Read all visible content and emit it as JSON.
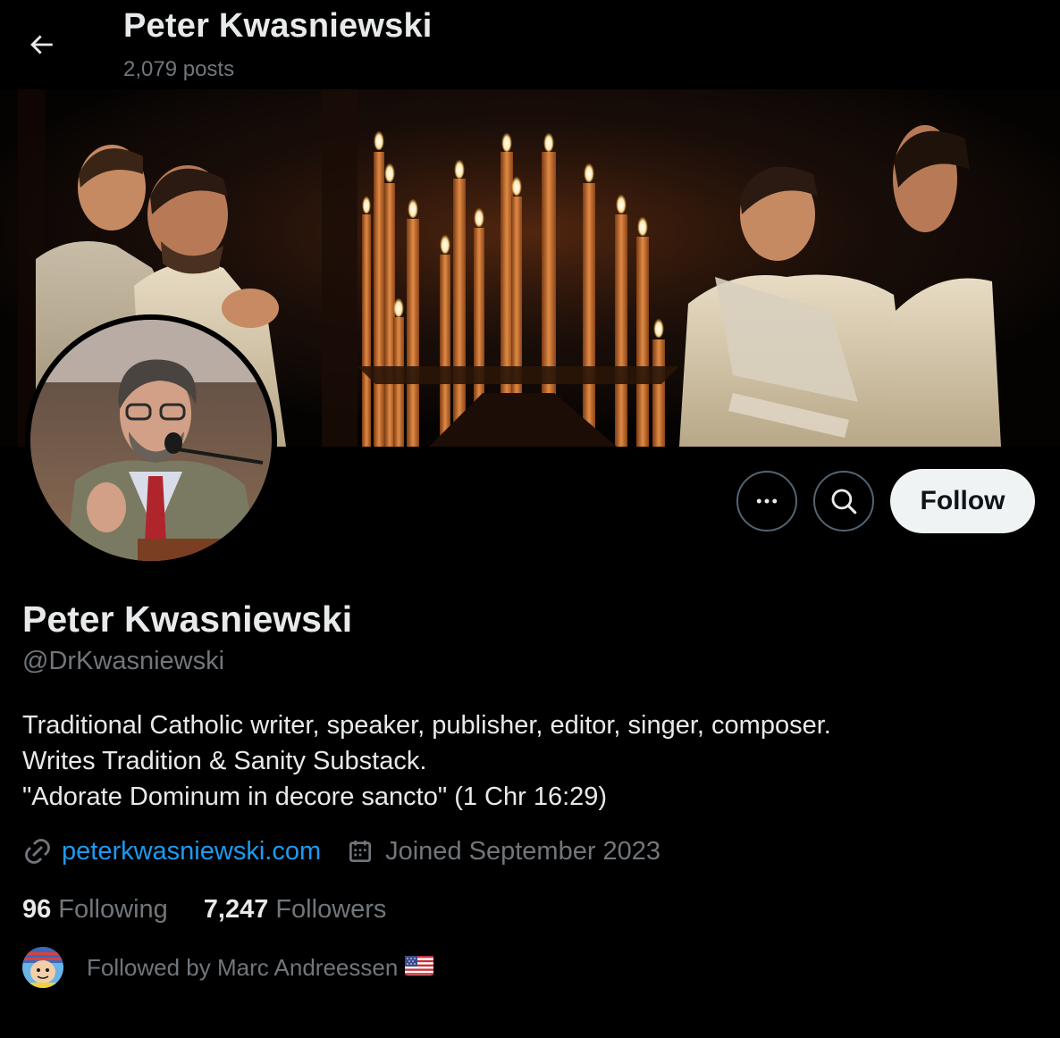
{
  "header": {
    "title": "Peter Kwasniewski",
    "posts_count": "2,079 posts",
    "back_icon": "arrow-left-icon"
  },
  "profile": {
    "name": "Peter Kwasniewski",
    "handle": "@DrKwasniewski",
    "bio_lines": [
      "Traditional Catholic writer, speaker, publisher, editor, singer, composer.",
      "Writes Tradition & Sanity Substack.",
      "\"Adorate Dominum in decore sancto\" (1 Chr 16:29)"
    ],
    "website": "peterkwasniewski.com",
    "joined": "Joined September 2023"
  },
  "actions": {
    "more_icon": "more-icon",
    "search_icon": "search-icon",
    "follow_label": "Follow"
  },
  "stats": {
    "following_count": "96",
    "following_label": "Following",
    "followers_count": "7,247",
    "followers_label": "Followers"
  },
  "followed_by": {
    "text": "Followed by Marc Andreessen"
  },
  "colors": {
    "background": "#000000",
    "text_primary": "#e7e9ea",
    "text_secondary": "#71767b",
    "link": "#1d9bf0",
    "follow_button_bg": "#eff3f4"
  }
}
